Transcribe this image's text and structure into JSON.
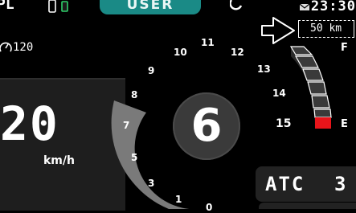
{
  "status_bar": {
    "left_text": "PL",
    "mode_label": "USER",
    "clock": "23:30",
    "left_icon": "phone-icon",
    "right_icon": "bluetooth-icon",
    "clock_icon": "mail-icon"
  },
  "speed": {
    "value": "20",
    "unit": "km/h"
  },
  "speed_limit": {
    "icon": "cruise-limit-icon",
    "value": "120"
  },
  "gear": "6",
  "rpm_scale": [
    "0",
    "1",
    "3",
    "5",
    "7",
    "8",
    "9",
    "10",
    "11",
    "12",
    "13",
    "14",
    "15"
  ],
  "fuel": {
    "range_value": "50 km",
    "full_label": "F",
    "empty_label": "E",
    "level_fraction": 0.1,
    "low_color": "#e8141a"
  },
  "atc": {
    "label": "ATC",
    "value": "3"
  },
  "colors": {
    "accent": "#1a8a86",
    "tach_arc": "#7a7a7a"
  }
}
